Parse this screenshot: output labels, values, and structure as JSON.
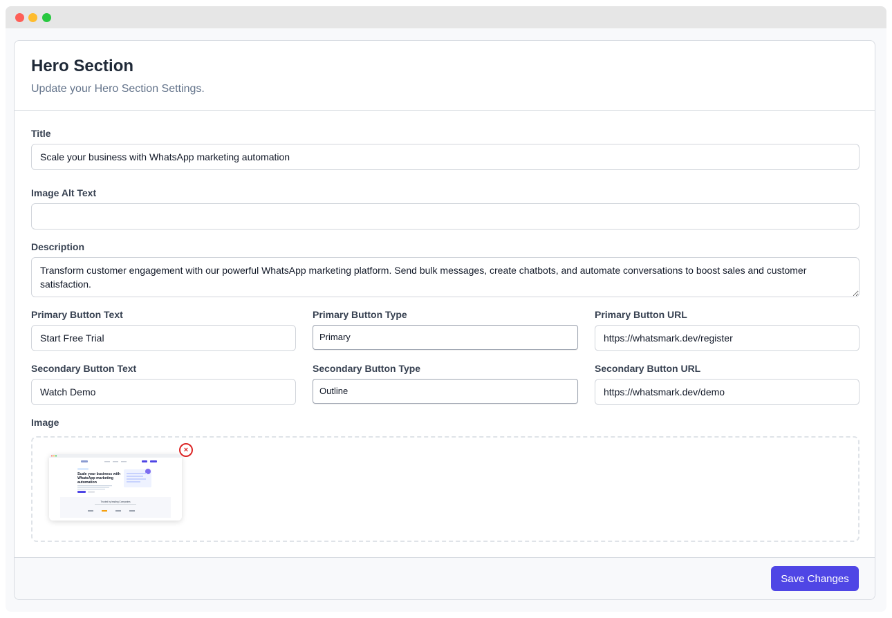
{
  "window": {
    "controls": [
      "close",
      "minimize",
      "maximize"
    ]
  },
  "header": {
    "title": "Hero Section",
    "subtitle": "Update your Hero Section Settings."
  },
  "form": {
    "title_label": "Title",
    "title_value": "Scale your business with WhatsApp marketing automation",
    "alt_label": "Image Alt Text",
    "alt_value": "",
    "description_label": "Description",
    "description_value": "Transform customer engagement with our powerful WhatsApp marketing platform. Send bulk messages, create chatbots, and automate conversations to boost sales and customer satisfaction.",
    "primary_text_label": "Primary Button Text",
    "primary_text_value": "Start Free Trial",
    "primary_type_label": "Primary Button Type",
    "primary_type_value": "Primary",
    "primary_url_label": "Primary Button URL",
    "primary_url_value": "https://whatsmark.dev/register",
    "secondary_text_label": "Secondary Button Text",
    "secondary_text_value": "Watch Demo",
    "secondary_type_label": "Secondary Button Type",
    "secondary_type_value": "Outline",
    "secondary_url_label": "Secondary Button URL",
    "secondary_url_value": "https://whatsmark.dev/demo",
    "image_label": "Image",
    "remove_icon": "×"
  },
  "preview": {
    "headline": "Scale your business with WhatsApp marketing automation",
    "trusted": "Trusted by leading Companies"
  },
  "footer": {
    "save_label": "Save Changes"
  },
  "colors": {
    "accent": "#4f46e5",
    "danger": "#dc2626"
  }
}
